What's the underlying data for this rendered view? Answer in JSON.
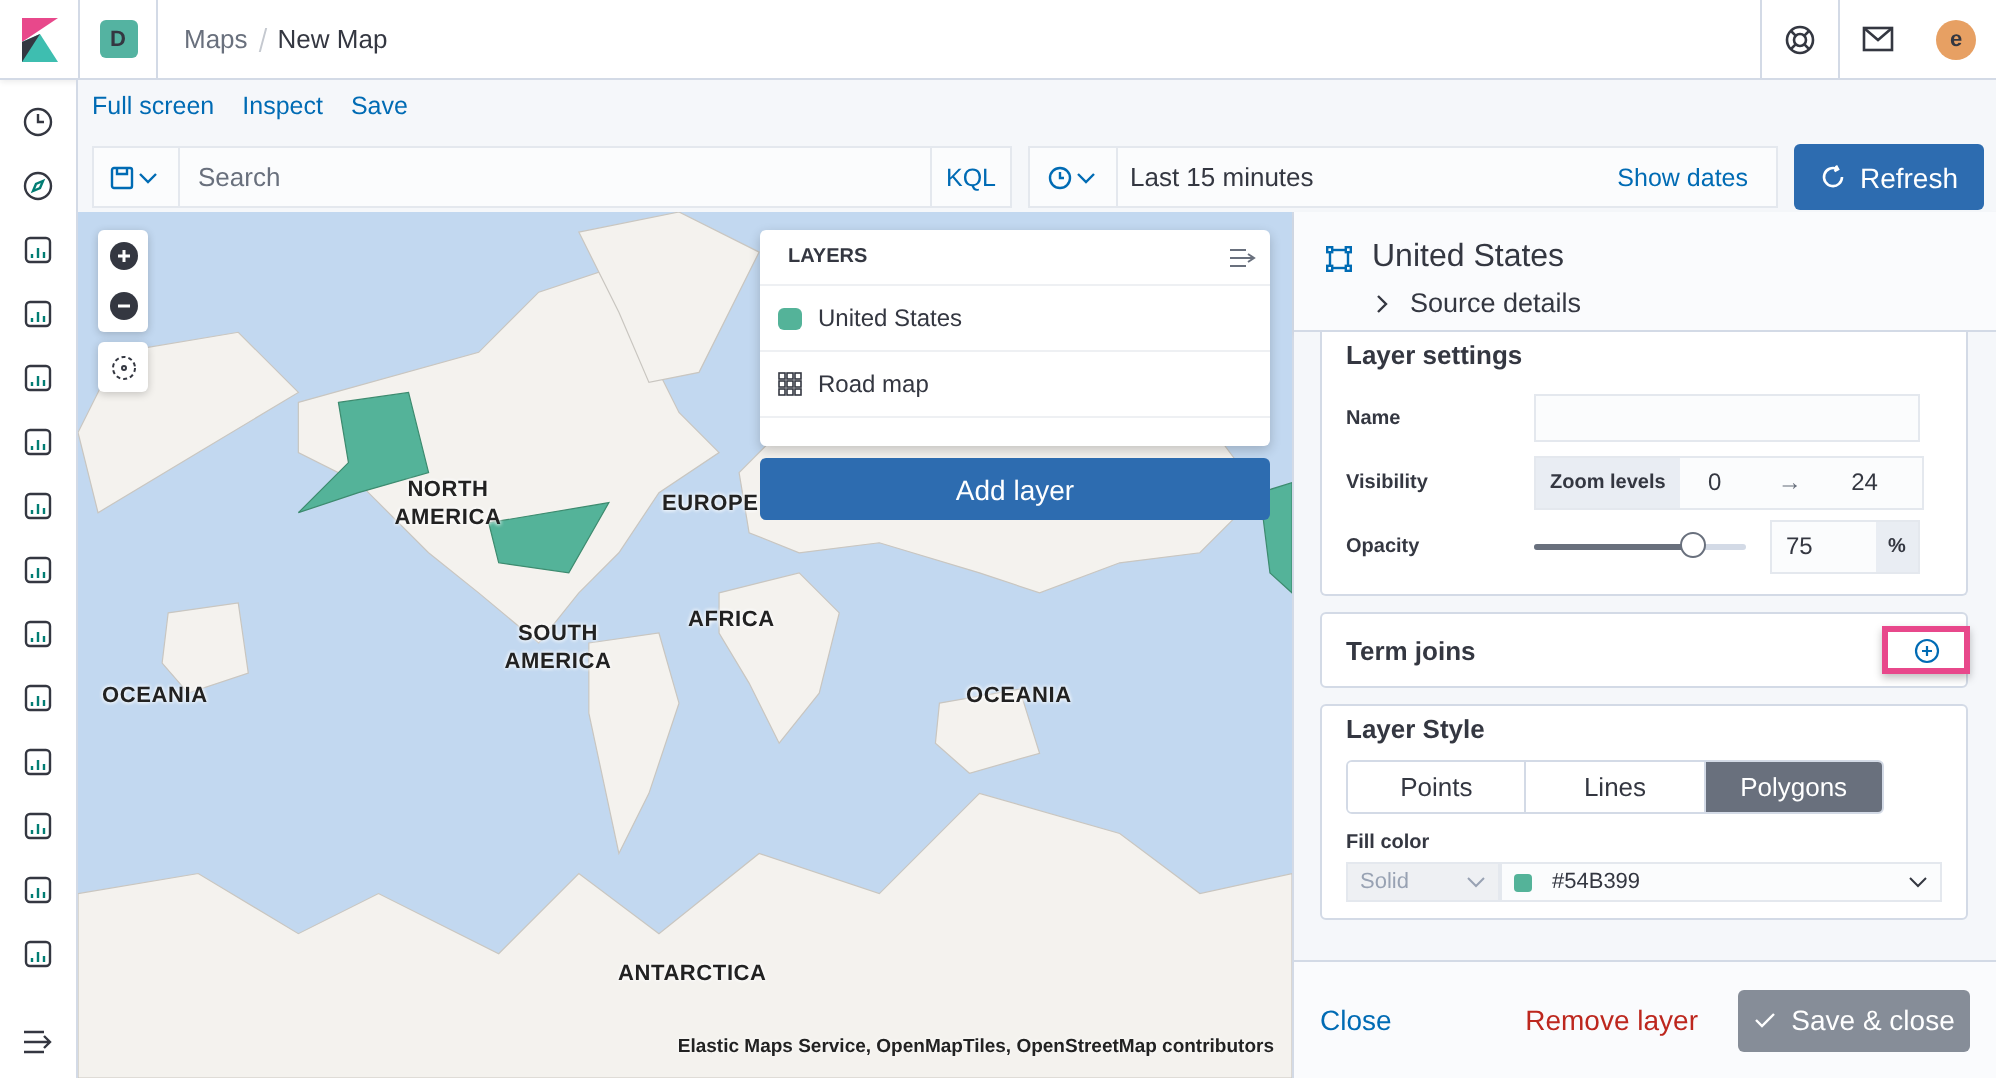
{
  "header": {
    "space_badge": "D",
    "breadcrumbs": [
      {
        "label": "Maps",
        "current": false
      },
      {
        "label": "New Map",
        "current": true
      }
    ],
    "avatar": "e"
  },
  "toolbar": {
    "links": [
      "Full screen",
      "Inspect",
      "Save"
    ],
    "search": {
      "placeholder": "Search"
    },
    "language": "KQL",
    "time": "Last 15 minutes",
    "show_dates": "Show dates",
    "refresh": "Refresh"
  },
  "map": {
    "labels": [
      {
        "text": "NORTH AMERICA"
      },
      {
        "text": "EUROPE"
      },
      {
        "text": "AFRICA"
      },
      {
        "text": "OCEANIA"
      },
      {
        "text": "SOUTH AMERICA"
      },
      {
        "text": "OCEANIA"
      },
      {
        "text": "ANTARCTICA"
      }
    ],
    "attribution": "Elastic Maps Service, OpenMapTiles, OpenStreetMap contributors"
  },
  "layers_panel": {
    "title": "LAYERS",
    "layers": [
      {
        "name": "United States",
        "kind": "vector",
        "color": "#54b399"
      },
      {
        "name": "Road map",
        "kind": "tile"
      }
    ],
    "add_layer": "Add layer"
  },
  "details": {
    "title": "United States",
    "source_details": "Source details",
    "expanded": false,
    "settings": {
      "title": "Layer settings",
      "name_label": "Name",
      "visibility_label": "Visibility",
      "zoom_label": "Zoom levels",
      "zoom_min": "0",
      "zoom_arrow": "→",
      "zoom_max": "24",
      "opacity_label": "Opacity",
      "opacity": {
        "level": 0.75,
        "value": "75",
        "unit": "%"
      }
    },
    "term_joins": {
      "title": "Term joins",
      "highlighted": true
    },
    "style": {
      "title": "Layer Style",
      "types": [
        {
          "label": "Points",
          "selected": false
        },
        {
          "label": "Lines",
          "selected": false
        },
        {
          "label": "Polygons",
          "selected": true
        }
      ],
      "fill_label": "Fill color",
      "fill_mode": "Solid",
      "fill_value": "#54B399"
    },
    "close": "Close",
    "remove": "Remove layer",
    "save": "Save & close",
    "save_disabled": true
  }
}
